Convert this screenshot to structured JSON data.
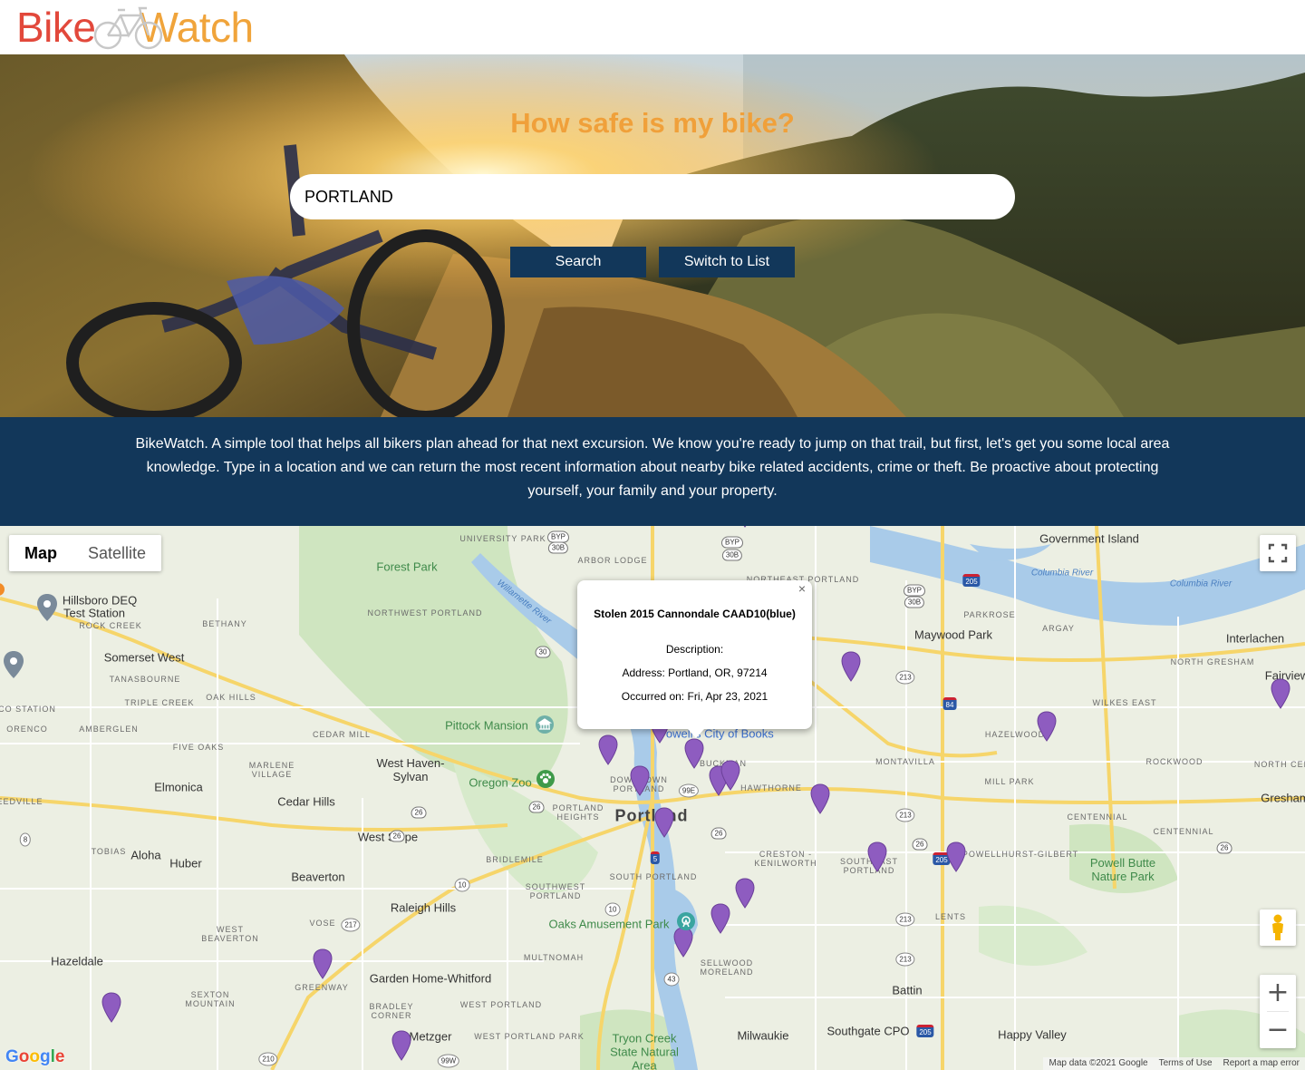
{
  "header": {
    "logo_part1": "Bike",
    "logo_part2": "Watch",
    "logo_colors": {
      "bike": "#e2483b",
      "watch": "#f0a43b"
    }
  },
  "hero": {
    "heading": "How safe is my bike?",
    "search_value": "PORTLAND",
    "search_button": "Search",
    "switch_button": "Switch to List"
  },
  "intro": {
    "text": "BikeWatch. A simple tool that helps all bikers plan ahead for that next excursion. We know you're ready to jump on that trail, but first, let's get you some local area knowledge. Type in a location and we can return the most recent information about nearby bike related accidents, crime or theft. Be proactive about protecting yourself, your family and your property."
  },
  "map": {
    "type_map": "Map",
    "type_satellite": "Satellite",
    "labels": {
      "university_park": "UNIVERSITY PARK",
      "arbor_lodge": "ARBOR LODGE",
      "government_island": "Government Island",
      "forest_park": "Forest Park",
      "northeast_portland": "NORTHEAST PORTLAND",
      "columbia_river_1": "Columbia River",
      "columbia_river_2": "Columbia River",
      "willamette_river": "Willamette River",
      "hillsboro_deq": "Hillsboro DEQ",
      "test_station": "Test Station",
      "rock_creek": "ROCK CREEK",
      "bethany": "BETHANY",
      "northwest_portland": "NORTHWEST PORTLAND",
      "parkrose": "PARKROSE",
      "argay": "ARGAY",
      "maywood_park": "Maywood Park",
      "interlachen": "Interlachen",
      "somerset_west": "Somerset West",
      "tanasbourne": "TANASBOURNE",
      "north_gresham": "NORTH GRESHAM",
      "triple_creek": "TRIPLE CREEK",
      "oak_hills": "OAK HILLS",
      "fairview": "Fairview",
      "wilkes_east": "WILKES EAST",
      "co_station": "CO STATION",
      "orenco": "ORENCO",
      "amberglen": "AMBERGLEN",
      "cedar_mill": "CEDAR MILL",
      "pittock_mansion": "Pittock Mansion",
      "powells": "Powell's City of Books",
      "hazelwood": "HAZELWOOD",
      "five_oaks": "FIVE OAKS",
      "montavilla": "MONTAVILLA",
      "rockwood": "ROCKWOOD",
      "north_cen": "NORTH CEN",
      "west_haven": "West Haven-Sylvan",
      "buckman": "BUCKMAN",
      "marlene_village": "MARLENE VILLAGE",
      "oregon_zoo": "Oregon Zoo",
      "downtown": "DOWNTOWN PORTLAND",
      "mill_park": "MILL PARK",
      "elmonica": "Elmonica",
      "hawthorne": "HAWTHORNE",
      "reedville": "EEDVILLE",
      "cedar_hills": "Cedar Hills",
      "portland_heights": "PORTLAND HEIGHTS",
      "portland": "Portland",
      "gresham": "Gresham",
      "centennial": "CENTENNIAL",
      "centennial2": "CENTENNIAL",
      "west_slope": "West Slope",
      "tobias": "TOBIAS",
      "aloha": "Aloha",
      "bridlemile": "BRIDLEMILE",
      "creston": "CRESTON - KENILWORTH",
      "southeast_portland": "SOUTHEAST PORTLAND",
      "powellhurst": "POWELLHURST-GILBERT",
      "powell_butte": "Powell Butte Nature Park",
      "huber": "Huber",
      "beaverton": "Beaverton",
      "south_portland": "SOUTH PORTLAND",
      "southwest_portland": "SOUTHWEST PORTLAND",
      "raleigh_hills": "Raleigh Hills",
      "vose": "VOSE",
      "oaks_park": "Oaks Amusement Park",
      "lents": "LENTS",
      "west_beaverton": "WEST BEAVERTON",
      "hazeldale": "Hazeldale",
      "multnomah": "MULTNOMAH",
      "garden_home": "Garden Home-Whitford",
      "greenway": "GREENWAY",
      "sellwood": "SELLWOOD MORELAND",
      "battin": "Battin",
      "sexton": "SEXTON MOUNTAIN",
      "bradley": "BRADLEY CORNER",
      "west_portland": "WEST PORTLAND",
      "metzger": "Metzger",
      "west_portland_park": "WEST PORTLAND PARK",
      "southgate": "Southgate CPO",
      "happy_valley": "Happy Valley",
      "milwaukie": "Milwaukie",
      "tryon": "Tryon Creek State Natural Area"
    },
    "shields": [
      "BYP",
      "30B",
      "BYP",
      "30B",
      "30B",
      "BYP",
      "205",
      "30",
      "84",
      "213",
      "213",
      "26",
      "26",
      "10",
      "5",
      "26",
      "213",
      "205",
      "26",
      "99E",
      "10",
      "217",
      "43",
      "213",
      "205",
      "210",
      "99W",
      "8",
      "26",
      "26"
    ],
    "infowindow": {
      "title": "Stolen 2015 Cannondale CAAD10(blue)",
      "description_label": "Description:",
      "description_value": "",
      "address_label": "Address:",
      "address_value": "Portland, OR, 97214",
      "occurred_label": "Occurred on:",
      "occurred_value": "Fri, Apr 23, 2021",
      "close": "×"
    },
    "pin_color": "#8e5cc0",
    "zoom_in": "+",
    "zoom_out": "−",
    "google": "Google",
    "attribution": {
      "map_data": "Map data ©2021 Google",
      "terms": "Terms of Use",
      "report": "Report a map error"
    }
  }
}
